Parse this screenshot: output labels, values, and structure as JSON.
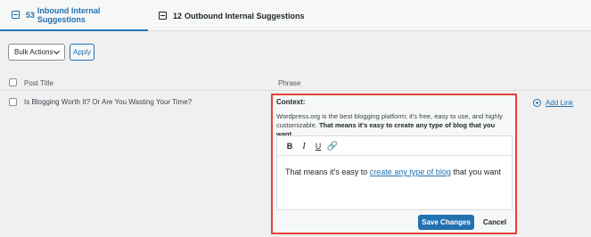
{
  "tabs": [
    {
      "count": "53",
      "label": "Inbound Internal Suggestions",
      "icon": "inbound-icon"
    },
    {
      "count": "12",
      "label": "Outbound Internal Suggestions",
      "icon": "outbound-icon"
    }
  ],
  "bulk": {
    "select_label": "Bulk Actions",
    "apply_label": "Apply"
  },
  "table": {
    "headers": {
      "post_title": "Post Title",
      "phrase": "Phrase"
    },
    "rows": [
      {
        "post_title": "Is Blogging Worth It? Or Are You Wasting Your Time?",
        "context_label": "Context:",
        "context_text": "Wordpress.org is the best blogging platform; it's free, easy to use, and highly customizable.",
        "context_bold": "That means it's easy to create any type of blog that you want.",
        "editor": {
          "before": "That means it's easy to ",
          "link": "create any type of blog",
          "after": " that you want"
        },
        "toolbar": {
          "bold": "B",
          "italic": "I",
          "underline": "U",
          "link": "🔗"
        },
        "save_label": "Save Changes",
        "cancel_label": "Cancel",
        "add_link_label": "Add Link"
      }
    ]
  },
  "colors": {
    "accent": "#2271b1",
    "highlight_border": "#e3433b"
  }
}
